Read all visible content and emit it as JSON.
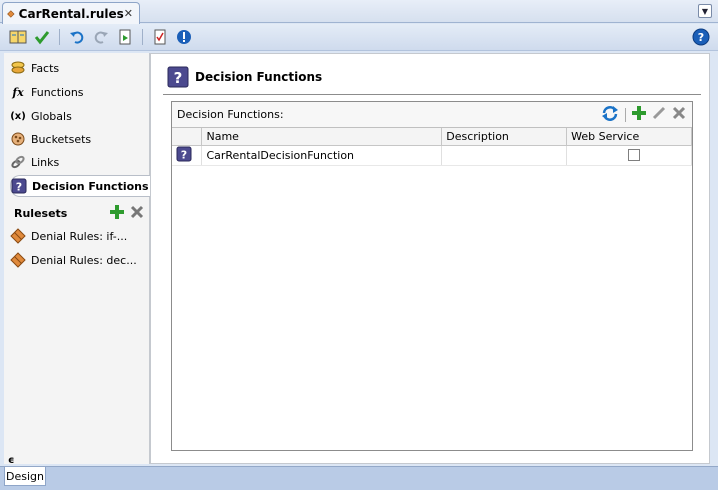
{
  "document_tab": {
    "title": "CarRental.rules"
  },
  "toolbar": {
    "icons": [
      "dictionary-icon",
      "validate-check-icon",
      "undo-icon",
      "redo-icon",
      "link-icon",
      "report-icon",
      "info-icon"
    ]
  },
  "sidebar": {
    "items": [
      {
        "label": "Facts",
        "icon": "facts-icon"
      },
      {
        "label": "Functions",
        "icon": "fx-icon"
      },
      {
        "label": "Globals",
        "icon": "globals-icon"
      },
      {
        "label": "Bucketsets",
        "icon": "bucketsets-icon"
      },
      {
        "label": "Links",
        "icon": "links-icon"
      },
      {
        "label": "Decision Functions",
        "icon": "decision-function-icon"
      }
    ],
    "selected": "Decision Functions",
    "rulesets_title": "Rulesets",
    "rulesets": [
      {
        "label": "Denial Rules: if-..."
      },
      {
        "label": "Denial Rules: dec..."
      }
    ]
  },
  "main": {
    "title": "Decision Functions",
    "panel_label": "Decision Functions:",
    "columns": [
      "Name",
      "Description",
      "Web Service"
    ],
    "rows": [
      {
        "name": "CarRentalDecisionFunction",
        "description": "",
        "web_service": false
      }
    ]
  },
  "bottom": {
    "tab": "Design",
    "collapse_glyph": "ϵ"
  },
  "colors": {
    "accent_blue": "#1b73c7",
    "add_green": "#2e9b2e",
    "delete_gray": "#777777",
    "icon_purple": "#4c4a8f"
  }
}
